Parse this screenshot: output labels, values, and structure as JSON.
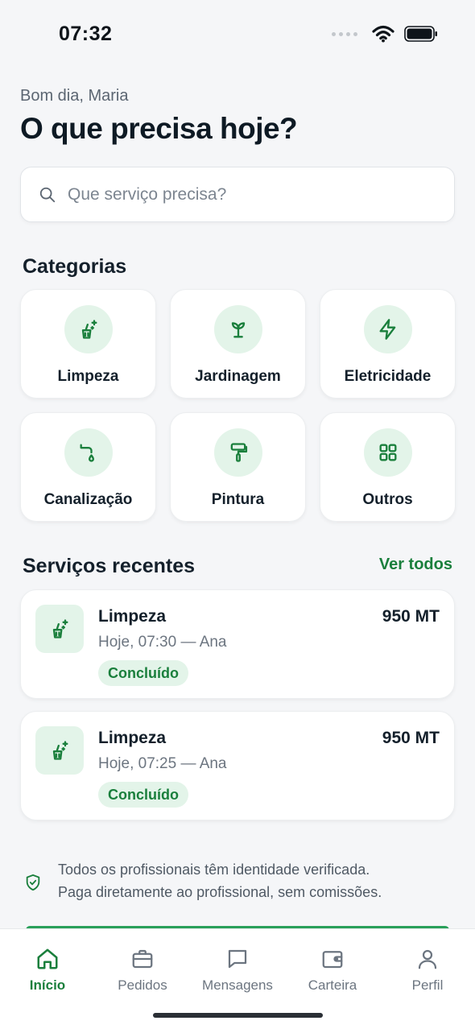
{
  "status_bar": {
    "time": "07:32"
  },
  "header": {
    "greeting": "Bom dia, Maria",
    "title": "O que precisa hoje?"
  },
  "search": {
    "placeholder": "Que serviço precisa?",
    "icon": "search-icon"
  },
  "categories": {
    "title": "Categorias",
    "items": [
      {
        "label": "Limpeza",
        "icon": "cleaning-icon"
      },
      {
        "label": "Jardinagem",
        "icon": "sprout-icon"
      },
      {
        "label": "Eletricidade",
        "icon": "lightning-icon"
      },
      {
        "label": "Canalização",
        "icon": "faucet-icon"
      },
      {
        "label": "Pintura",
        "icon": "paint-roller-icon"
      },
      {
        "label": "Outros",
        "icon": "grid-icon"
      }
    ]
  },
  "recent": {
    "title": "Serviços recentes",
    "see_all": "Ver todos",
    "items": [
      {
        "title": "Limpeza",
        "subtitle": "Hoje, 07:30 — Ana",
        "price": "950 MT",
        "status": "Concluído",
        "icon": "cleaning-icon"
      },
      {
        "title": "Limpeza",
        "subtitle": "Hoje, 07:25 — Ana",
        "price": "950 MT",
        "status": "Concluído",
        "icon": "cleaning-icon"
      }
    ]
  },
  "trust": {
    "line1": "Todos os profissionais têm identidade verificada.",
    "line2": "Paga diretamente ao profissional, sem comissões.",
    "icon": "shield-check-icon"
  },
  "tabs": [
    {
      "label": "Início",
      "icon": "home-icon",
      "active": true
    },
    {
      "label": "Pedidos",
      "icon": "briefcase-icon",
      "active": false
    },
    {
      "label": "Mensagens",
      "icon": "chat-icon",
      "active": false
    },
    {
      "label": "Carteira",
      "icon": "wallet-icon",
      "active": false
    },
    {
      "label": "Perfil",
      "icon": "user-icon",
      "active": false
    }
  ],
  "colors": {
    "accent": "#1a7f3c",
    "accent_soft": "#e3f4e9",
    "background": "#f5f6f8",
    "text": "#14202b",
    "muted": "#6c7580"
  }
}
